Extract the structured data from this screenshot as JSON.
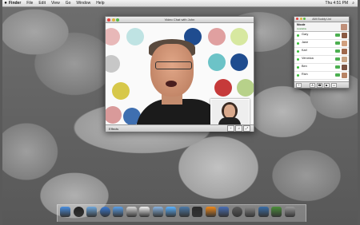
{
  "menubar": {
    "app": "Finder",
    "items": [
      "File",
      "Edit",
      "View",
      "Go",
      "Window",
      "Help"
    ],
    "clock": "Thu 4:51 PM"
  },
  "video_window": {
    "title": "Video Chat with John",
    "effects_label": "Effects"
  },
  "buddy_list": {
    "title": "AIM Buddy List",
    "me": {
      "name": "Nicole",
      "status": "Available"
    },
    "buddies": [
      {
        "name": "Gary"
      },
      {
        "name": "Jane"
      },
      {
        "name": "Karl"
      },
      {
        "name": "Veronica"
      },
      {
        "name": "Ben"
      },
      {
        "name": "Rich"
      }
    ]
  },
  "colors": {
    "dots": [
      "#e8b8b8",
      "#bfe3e3",
      "#d7c84a",
      "#c7c7c7",
      "#c63a3a",
      "#3f6fb0",
      "#1f4c8f",
      "#6cc3c7",
      "#b7d18a",
      "#d99a9a"
    ],
    "available": "#3cbd3c"
  },
  "dock_icons": [
    "finder-icon",
    "dashboard-icon",
    "mail-icon",
    "safari-icon",
    "ichat-icon",
    "addressbook-icon",
    "ical-icon",
    "preview-icon",
    "itunes-icon",
    "iphoto-icon",
    "imovie-icon",
    "garageband-icon",
    "spaces-icon",
    "timemachine-icon",
    "systemprefs-icon",
    "downloads-icon",
    "documents-icon",
    "trash-icon"
  ]
}
